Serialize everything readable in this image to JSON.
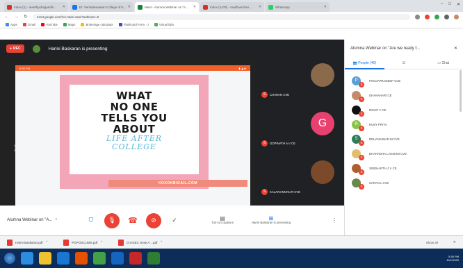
{
  "browser": {
    "tabs": [
      {
        "label": "Inbox (1) - meethyshagandhi...",
        "color": "#d93025",
        "active": false
      },
      {
        "label": "Dr. Venkateswaran College of E...",
        "color": "#1a73e8",
        "active": false
      },
      {
        "label": "Meet - Alumna Webinar on \"A...",
        "color": "#188038",
        "active": true
      },
      {
        "label": "Inbox (1479) - madhivechari...",
        "color": "#d93025",
        "active": false
      },
      {
        "label": "WhatsApp",
        "color": "#25d366",
        "active": false
      }
    ],
    "url": "meet.google.com/rce-nadv-oaw/?authuser=0",
    "bookmarks": [
      "Apps",
      "Gmail",
      "YouTube",
      "Maps",
      "Brokerage calculator",
      "Flashcard Form - J",
      "Virtual labs"
    ]
  },
  "meet": {
    "rec_label": "REC",
    "presenting_text": "Harini Baskaran is presenting",
    "slide": {
      "phone_time": "5:26 PM",
      "lines": [
        "WHAT",
        "NO ONE",
        "TELLS YOU",
        "ABOUT"
      ],
      "script_lines": [
        "LIFE AFTER",
        "COLLEGE"
      ],
      "site": "KOKOKBIGAIL.COM"
    },
    "tiles": [
      {
        "name": "CHARAN CVE",
        "photo_color": "#8a6a4a"
      },
      {
        "name": "GOPINATH A V CE",
        "initial": "G",
        "photo_color": "#e8416f"
      },
      {
        "name": "KALAIVANNAN R CVE",
        "photo_color": "#7a4a2a"
      }
    ],
    "meeting_name": "Alumna Webinar on \"A...",
    "captions_label": "Turn on captions",
    "presenting_label": "Harini Baskaran is presenting"
  },
  "side_panel": {
    "title": "Alumna Webinar on \"Are we ready f...",
    "tabs": [
      "People (40)",
      "",
      "Chat"
    ],
    "people": [
      {
        "name": "POOJAPRADEEP CUE",
        "initial": "P",
        "color": "#5aa0d8"
      },
      {
        "name": "DHANAHARI CE",
        "initial": "",
        "color": "#c58a6a"
      },
      {
        "name": "ROHIT V CE",
        "initial": "",
        "color": "#111111"
      },
      {
        "name": "RUBY PRIYA",
        "initial": "R",
        "color": "#8bc34a"
      },
      {
        "name": "DELVAKUMAR M CVE",
        "initial": "S",
        "color": "#2e7d5b"
      },
      {
        "name": "DHARADHA LAKSHMI CVE",
        "initial": "",
        "color": "#e0c070"
      },
      {
        "name": "SIDDHARTH J V CE",
        "initial": "",
        "color": "#b06030"
      },
      {
        "name": "SARAN L CVE",
        "initial": "",
        "color": "#6a8a4a"
      }
    ]
  },
  "downloads": {
    "files": [
      "Harini Baskaran.pdf",
      "PGPOSCUMS.pdf",
      "CIVISEC Sese A ...pdf"
    ],
    "show_all": "Show all"
  },
  "taskbar": {
    "time": "5:36 PM",
    "date": "10/1/2020",
    "apps": [
      "#2b8ce0",
      "#f2c12e",
      "#1976d2",
      "#e65100",
      "#43a047",
      "#1565c0",
      "#c62828",
      "#2e7d32"
    ]
  }
}
